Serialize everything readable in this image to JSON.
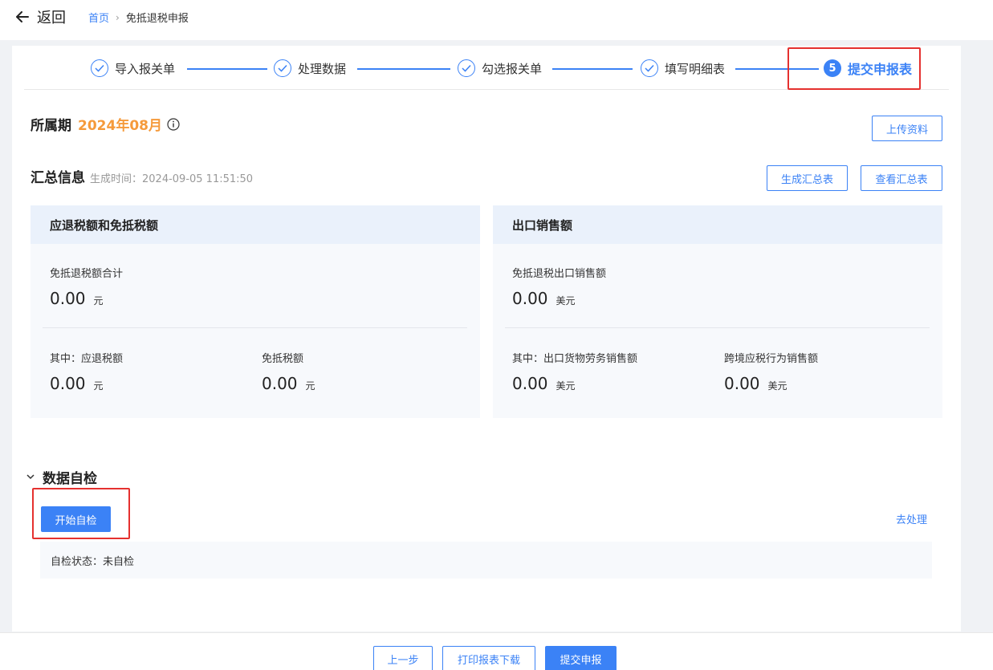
{
  "header": {
    "back_label": "返回",
    "breadcrumb": {
      "home": "首页",
      "separator": "›",
      "current": "免抵退税申报"
    }
  },
  "steps": [
    {
      "label": "导入报关单",
      "state": "done"
    },
    {
      "label": "处理数据",
      "state": "done"
    },
    {
      "label": "勾选报关单",
      "state": "done"
    },
    {
      "label": "填写明细表",
      "state": "done"
    },
    {
      "label": "提交申报表",
      "state": "active",
      "number": "5"
    }
  ],
  "period": {
    "label": "所属期",
    "value": "2024年08月"
  },
  "upload_button": "上传资料",
  "summary": {
    "title": "汇总信息",
    "generated": "生成时间：2024-09-05 11:51:50",
    "generate_button": "生成汇总表",
    "view_button": "查看汇总表"
  },
  "refund_card": {
    "title": "应退税额和免抵税额",
    "total_label": "免抵退税额合计",
    "total_value": "0.00",
    "total_unit": "元",
    "sub1_label": "其中：应退税额",
    "sub1_value": "0.00",
    "sub1_unit": "元",
    "sub2_label": "免抵税额",
    "sub2_value": "0.00",
    "sub2_unit": "元"
  },
  "sales_card": {
    "title": "出口销售额",
    "total_label": "免抵退税出口销售额",
    "total_value": "0.00",
    "total_unit": "美元",
    "sub1_label": "其中：出口货物劳务销售额",
    "sub1_value": "0.00",
    "sub1_unit": "美元",
    "sub2_label": "跨境应税行为销售额",
    "sub2_value": "0.00",
    "sub2_unit": "美元"
  },
  "self_check": {
    "title": "数据自检",
    "start_button": "开始自检",
    "goto_link": "去处理",
    "status": "自检状态：未自检"
  },
  "footer": {
    "prev_button": "上一步",
    "print_button": "打印报表下载",
    "submit_button": "提交申报"
  },
  "colors": {
    "primary": "#3b82f6",
    "accent": "#f59a3b",
    "highlight": "#e5312f"
  }
}
